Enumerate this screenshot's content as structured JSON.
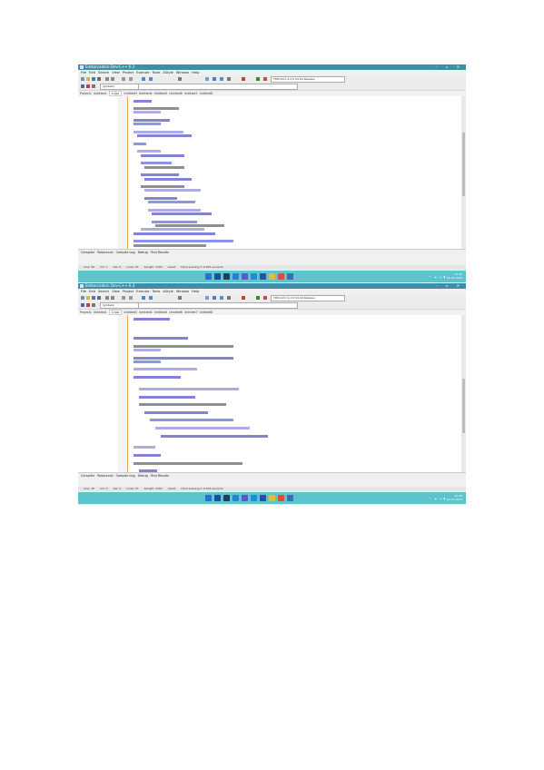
{
  "screens": [
    {
      "title": "Embarcadero Dev-C++ 6.3",
      "menu": [
        "File",
        "Edit",
        "Search",
        "View",
        "Project",
        "Execute",
        "Tools",
        "AStyle",
        "Window",
        "Help"
      ],
      "toolbar_combo": "TDM-GCC 9.2.0 64-bit Release",
      "toolbar_combo2": "(globals)",
      "tabs": [
        "Project1",
        "Untitled1",
        "x.cpp",
        "Untitled3",
        "Untitled4",
        "Untitled5",
        "Untitled6",
        "Untitled7",
        "Untitled8"
      ],
      "bottom_tabs": [
        "Compiler",
        "Resources",
        "Compile Log",
        "Debug",
        "Find Results"
      ],
      "status": [
        "Line: 50",
        "Col: 1",
        "Sel: 0",
        "Lines: 51",
        "Length: 1303",
        "Insert",
        "Done parsing in 0.015 seconds"
      ],
      "tray_time": "15:40",
      "tray_date": "22-12-2023"
    },
    {
      "title": "Embarcadero Dev-C++ 6.3",
      "menu": [
        "File",
        "Edit",
        "Search",
        "View",
        "Project",
        "Execute",
        "Tools",
        "AStyle",
        "Window",
        "Help"
      ],
      "toolbar_combo": "TDM-GCC 9.2.0 64-bit Release",
      "toolbar_combo2": "(globals)",
      "tabs": [
        "Project1",
        "Untitled1",
        "x.cpp",
        "Untitled3",
        "Untitled4",
        "Untitled5",
        "Untitled6",
        "Untitled7",
        "Untitled8"
      ],
      "bottom_tabs": [
        "Compiler",
        "Resources",
        "Compile Log",
        "Debug",
        "Find Results"
      ],
      "status": [
        "Line: 40",
        "Col: 5",
        "Sel: 0",
        "Lines: 51",
        "Length: 1303",
        "Insert",
        "Done parsing in 0.015 seconds"
      ],
      "tray_time": "15:42",
      "tray_date": "22-12-2023"
    }
  ],
  "taskbar_icons": [
    "start-icon",
    "search-icon",
    "task-view-icon",
    "widgets-icon",
    "chat-icon",
    "edge-icon",
    "store-icon",
    "explorer-icon",
    "chrome-icon",
    "devcpp-icon"
  ],
  "taskbar_colors": [
    "#2b6fd6",
    "#1b4f9c",
    "#233b5e",
    "#2a7fd4",
    "#5b59c9",
    "#1c8fd1",
    "#2b4fa8",
    "#e5b93c",
    "#e24a33",
    "#3a6fb0"
  ],
  "colors": {
    "titlebar": "#3d8fa6",
    "taskbar": "#5dc3cc",
    "keyword": "#1e1eb3",
    "string": "#2f3bd6"
  }
}
